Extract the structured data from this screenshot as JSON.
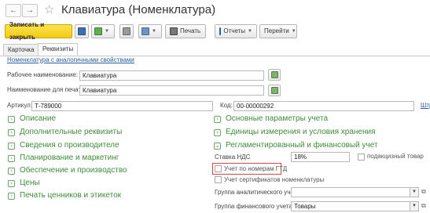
{
  "window": {
    "title": "Клавиатура (Номенклатура)"
  },
  "nav": {
    "back": "←",
    "forward": "→",
    "star": "☆"
  },
  "toolbar": {
    "save_close": "Записать и закрыть",
    "print": "Печать",
    "reports": "Отчеты",
    "goto": "Перейти"
  },
  "tabs": [
    "Карточка",
    "Реквизиты"
  ],
  "similar_link": "Номенклатура с аналогичными свойствами",
  "fields": {
    "work_name_label": "Рабочее наименование:",
    "work_name_value": "Клавиатура",
    "print_name_label": "Наименование для печати:",
    "print_name_value": "Клавиатура",
    "article_label": "Артикул:",
    "article_value": "Т-789000",
    "code_label": "Код:",
    "code_value": "00-00000292",
    "barcode_link": "Штр"
  },
  "left_groups": [
    {
      "label": "Описание",
      "state": "collapsed"
    },
    {
      "label": "Дополнительные реквизиты",
      "state": "collapsed"
    },
    {
      "label": "Сведения о производителе",
      "state": "collapsed"
    },
    {
      "label": "Планирование и маркетинг",
      "state": "collapsed"
    },
    {
      "label": "Обеспечение и производство",
      "state": "collapsed"
    },
    {
      "label": "Цены",
      "state": "collapsed"
    },
    {
      "label": "Печать ценников и этикеток",
      "state": "collapsed"
    }
  ],
  "right_groups": [
    {
      "label": "Основные параметры учета",
      "state": "collapsed"
    },
    {
      "label": "Единицы измерения и условия хранения",
      "state": "collapsed"
    },
    {
      "label": "Регламентированный и финансовый учет",
      "state": "expanded"
    }
  ],
  "reg": {
    "vat_label": "Ставка НДС",
    "vat_value": "18%",
    "excise_label": "подакцизный товар",
    "gtd_label": "Учет по номерам ГТД",
    "certs_label": "Учет сертификатов номенклатуры",
    "analytic_group_label": "Группа аналитического учета:",
    "analytic_group_value": "",
    "fin_group_label": "Группа финансового учета:",
    "fin_group_value": "Товары"
  },
  "colors": {
    "accent_yellow": "#f3cb10",
    "group_green": "#3f8e3a",
    "link_blue": "#2b5e9e",
    "highlight_red": "#e0443b"
  }
}
